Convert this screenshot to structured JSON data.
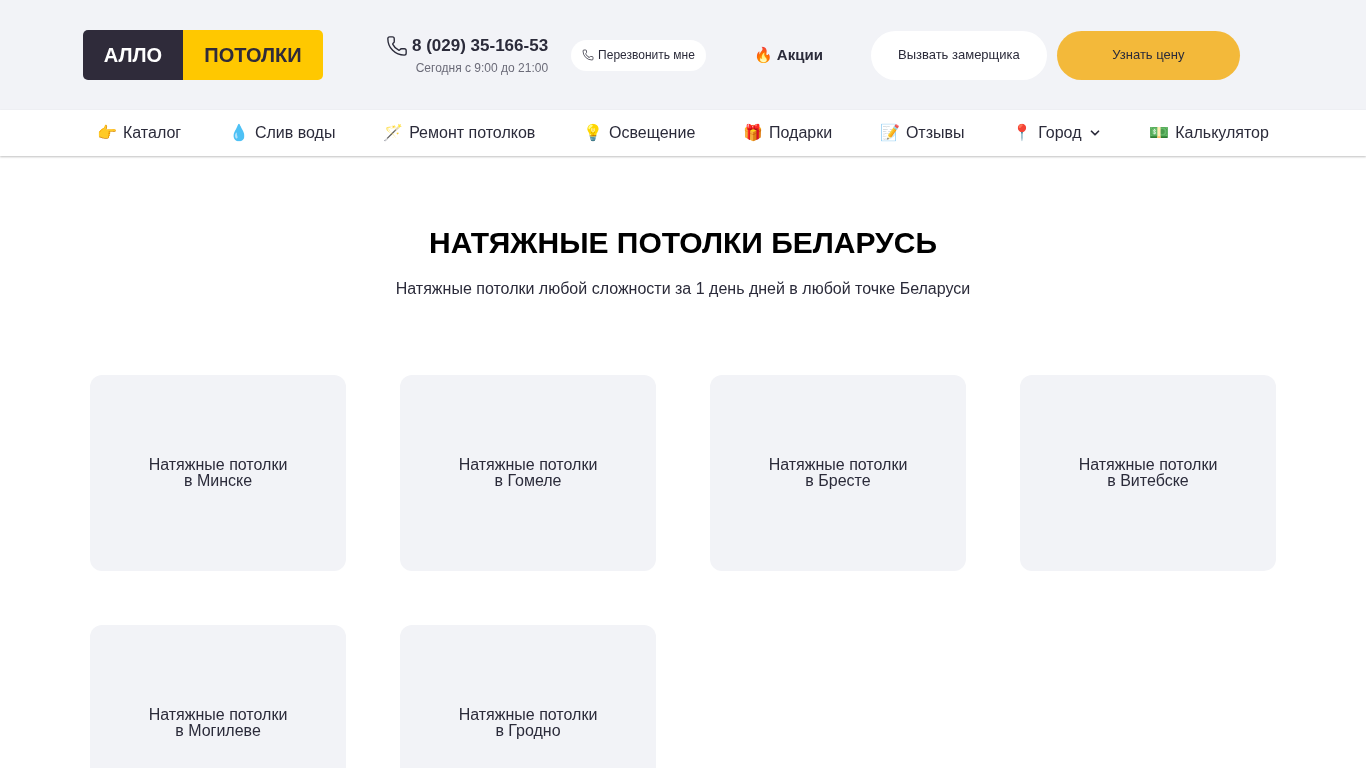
{
  "header": {
    "logo": {
      "left": "АЛЛО",
      "right": "ПОТОЛКИ"
    },
    "phone": "8 (029) 35-166-53",
    "hours": "Сегодня с 9:00 до 21:00",
    "callback_button": "Перезвонить мне",
    "promo": {
      "icon": "🔥",
      "label": "Акции"
    },
    "buttons": [
      {
        "label": "Вызвать замерщика",
        "kind": "secondary"
      },
      {
        "label": "Узнать цену",
        "kind": "primary"
      }
    ]
  },
  "nav": [
    {
      "icon": "👉",
      "label": "Каталог",
      "dropdown": false
    },
    {
      "icon": "💧",
      "label": "Слив воды",
      "dropdown": false
    },
    {
      "icon": "🪄",
      "label": "Ремонт потолков",
      "dropdown": false
    },
    {
      "icon": "💡",
      "label": "Освещение",
      "dropdown": false
    },
    {
      "icon": "🎁",
      "label": "Подарки",
      "dropdown": false
    },
    {
      "icon": "📝",
      "label": "Отзывы",
      "dropdown": false
    },
    {
      "icon": "📍",
      "label": "Город",
      "dropdown": true
    },
    {
      "icon": "💵",
      "label": "Калькулятор",
      "dropdown": false
    }
  ],
  "hero": {
    "title": "НАТЯЖНЫЕ ПОТОЛКИ БЕЛАРУСЬ",
    "subtitle": "Натяжные потолки любой сложности за 1 день дней в любой точке Беларуси"
  },
  "cities": [
    {
      "lines": [
        "Натяжные потолки",
        "в Минске"
      ]
    },
    {
      "lines": [
        "Натяжные потолки",
        "в Гомеле"
      ]
    },
    {
      "lines": [
        "Натяжные потолки",
        "в Бресте"
      ]
    },
    {
      "lines": [
        "Натяжные потолки",
        "в Витебске"
      ]
    },
    {
      "lines": [
        "Натяжные потолки",
        "в Могилеве"
      ]
    },
    {
      "lines": [
        "Натяжные потолки",
        "в Гродно"
      ]
    }
  ]
}
